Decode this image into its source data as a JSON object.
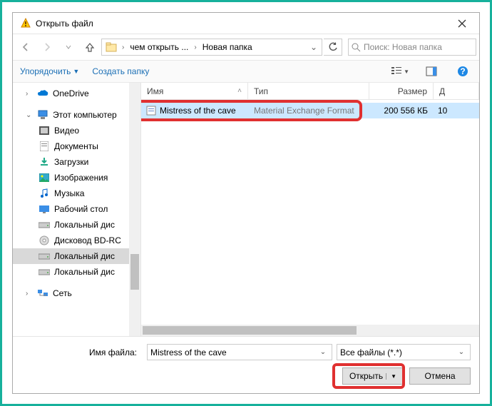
{
  "window": {
    "title": "Открыть файл"
  },
  "breadcrumb": {
    "seg1": "чем открыть ...",
    "seg2": "Новая папка"
  },
  "search": {
    "placeholder": "Поиск: Новая папка"
  },
  "toolbar": {
    "organize": "Упорядочить",
    "newfolder": "Создать папку"
  },
  "columns": {
    "name": "Имя",
    "type": "Тип",
    "size": "Размер",
    "date": "Д"
  },
  "sidebar": {
    "onedrive": "OneDrive",
    "thispc": "Этот компьютер",
    "videos": "Видео",
    "documents": "Документы",
    "downloads": "Загрузки",
    "pictures": "Изображения",
    "music": "Музыка",
    "desktop": "Рабочий стол",
    "localdisk1": "Локальный дис",
    "bdrom": "Дисковод BD-RC",
    "localdisk2": "Локальный дис",
    "localdisk3": "Локальный дис",
    "network": "Сеть"
  },
  "file": {
    "name": "Mistress of the cave",
    "type": "Material Exchange Format",
    "size": "200 556 КБ",
    "date": "10"
  },
  "bottom": {
    "filename_label": "Имя файла:",
    "filename_value": "Mistress of the cave",
    "filter": "Все файлы (*.*)",
    "open": "Открыть",
    "cancel": "Отмена"
  }
}
